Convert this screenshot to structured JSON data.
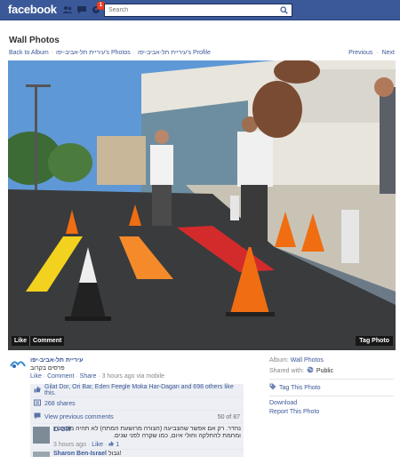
{
  "topbar": {
    "logo": "facebook",
    "search_placeholder": "Search",
    "notifications_badge": "1",
    "icons": [
      "friend-requests-icon",
      "messages-icon",
      "notifications-icon",
      "search-icon"
    ]
  },
  "header": {
    "title": "Wall Photos",
    "back_link": "Back to Album",
    "album_owner": "עיריית תל-אביב-יפו",
    "separator": "·",
    "photos_link": "עיריית תל-אביב-יפו's Photos",
    "profile_link": "עיריית תל-אביב-יפו's Profile",
    "previous": "Previous",
    "next": "Next"
  },
  "photo": {
    "like_button": "Like",
    "comment_button": "Comment",
    "tag_button": "Tag Photo"
  },
  "post": {
    "author": "עיריית תל-אביב-יפו",
    "text": "פרסים בקרוב",
    "actions": {
      "like": "Like",
      "comment": "Comment",
      "share": "Share",
      "meta": "3 hours ago via mobile"
    }
  },
  "ufi": {
    "likes_text": "Gilat Dor, Ori Bar, Eden Feegle Moka Har-Dagan and 698 others like this.",
    "shares_text": "268 shares",
    "view_previous": "View previous comments",
    "comment_count": "50 of 87"
  },
  "comments": [
    {
      "name": "Li Gill",
      "text": "נהדר. רק אם אפשר שהצביעה (הצורה מרושעת המתח) לא תהיה מסוכנת ומחמת להחלקה וחולי איום, כמו שקרה לפני שנים.",
      "meta": "3 hours ago",
      "like_link": "Like",
      "likes": "1"
    },
    {
      "name": "Sharon Ben-Israel",
      "text": "גבול!"
    }
  ],
  "sidebar": {
    "album_label": "Album:",
    "album_value": "Wall Photos",
    "shared_label": "Shared with:",
    "shared_value": "Public",
    "tag_this_photo": "Tag This Photo",
    "download": "Download",
    "report": "Report This Photo"
  },
  "colors": {
    "brand_blue": "#3b5998",
    "ufi_background": "#edeff4",
    "badge_red": "#f03d25"
  }
}
